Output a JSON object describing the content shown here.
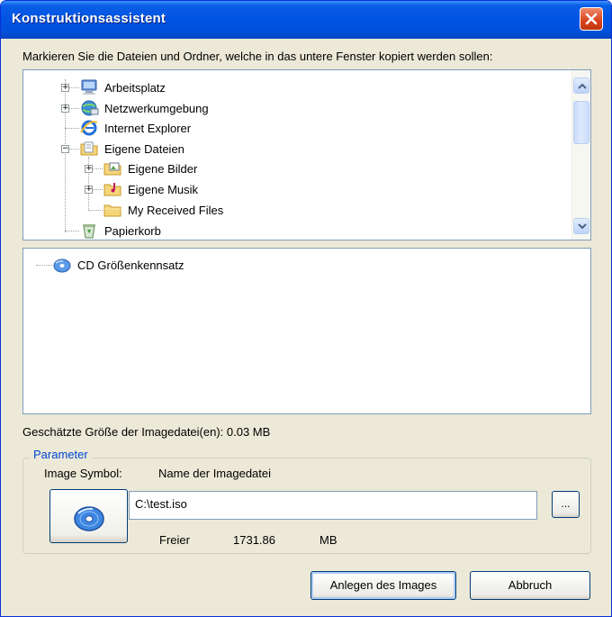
{
  "window": {
    "title": "Konstruktionsassistent"
  },
  "instruction": "Markieren Sie die Dateien und Ordner, welche in das untere Fenster kopiert werden sollen:",
  "source_tree": {
    "items": [
      {
        "label": "Arbeitsplatz",
        "icon": "computer-icon",
        "expander": "+"
      },
      {
        "label": "Netzwerkumgebung",
        "icon": "network-icon",
        "expander": "+"
      },
      {
        "label": "Internet Explorer",
        "icon": "internet-explorer-icon",
        "expander": ""
      },
      {
        "label": "Eigene Dateien",
        "icon": "documents-folder-icon",
        "expander": "−"
      },
      {
        "label": "Eigene Bilder",
        "icon": "pictures-folder-icon",
        "expander": "+"
      },
      {
        "label": "Eigene Musik",
        "icon": "music-folder-icon",
        "expander": "+"
      },
      {
        "label": "My Received Files",
        "icon": "folder-icon",
        "expander": ""
      },
      {
        "label": "Papierkorb",
        "icon": "recycle-bin-icon",
        "expander": ""
      }
    ]
  },
  "target_tree": {
    "items": [
      {
        "label": "CD Größenkennsatz",
        "icon": "cd-icon"
      }
    ]
  },
  "estimate": {
    "text": "Geschätzte Größe der Imagedatei(en): 0.03 MB"
  },
  "parameter": {
    "legend": "Parameter",
    "image_symbol_label": "Image Symbol:",
    "image_name_label": "Name der Imagedatei",
    "image_path_value": "C:\\test.iso",
    "browse_label": "...",
    "free_label": "Freier",
    "free_value": "1731.86",
    "free_unit": "MB"
  },
  "buttons": {
    "create": "Anlegen des Images",
    "cancel": "Abbruch"
  },
  "colors": {
    "title_bar": "#0054e3",
    "close_button": "#d6411c",
    "dialog_bg": "#ece9d8",
    "group_legend": "#0046d5"
  }
}
